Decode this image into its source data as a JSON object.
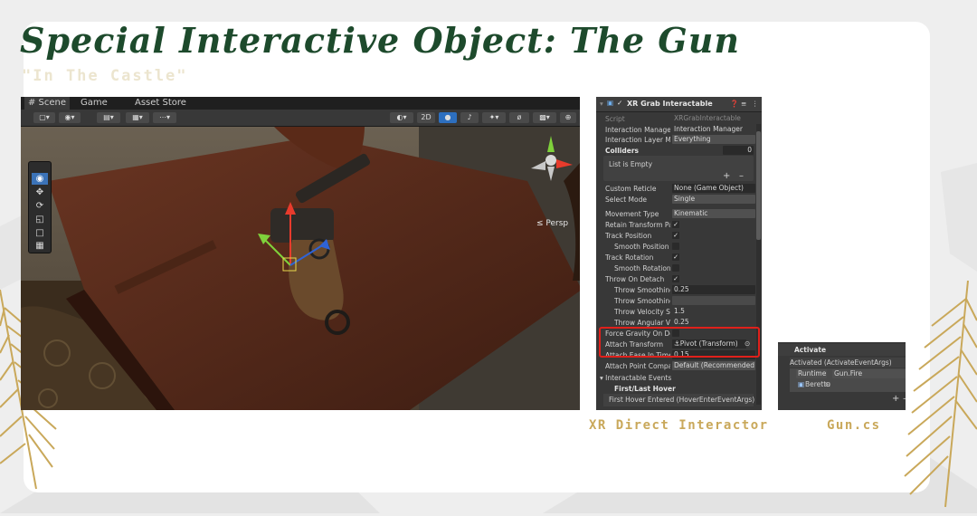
{
  "slide": {
    "title": "Special Interactive Object: The Gun",
    "subtitle": "\"In The Castle\"",
    "caption_inspector": "XR Direct Interactor",
    "caption_event": "Gun.cs",
    "colors": {
      "title": "#1d4a2c",
      "caption": "#c9a85a",
      "highlight": "#e0201b"
    }
  },
  "scene": {
    "tabs": [
      "# Scene",
      "Game",
      "Asset Store"
    ],
    "toolbar": {
      "mode_2d": "2D"
    },
    "persp_label": "≤ Persp",
    "tools": [
      "view-tool-icon",
      "move-tool-icon",
      "rotate-tool-icon",
      "scale-tool-icon",
      "rect-tool-icon",
      "transform-tool-icon"
    ]
  },
  "inspector": {
    "component": "XR Grab Interactable",
    "rows": {
      "script": {
        "label": "Script",
        "value": "XRGrabInteractable"
      },
      "interaction_manager": {
        "label": "Interaction Manager",
        "value": "Interaction Manager"
      },
      "interaction_layer": {
        "label": "Interaction Layer Ma",
        "value": "Everything"
      },
      "colliders": {
        "label": "Colliders",
        "value": "0"
      },
      "list_empty": "List is Empty",
      "custom_reticle": {
        "label": "Custom Reticle",
        "value": "None (Game Object)"
      },
      "select_mode": {
        "label": "Select Mode",
        "value": "Single"
      },
      "movement_type": {
        "label": "Movement Type",
        "value": "Kinematic"
      },
      "retain_transform": {
        "label": "Retain Transform Pa"
      },
      "track_position": {
        "label": "Track Position"
      },
      "smooth_position": {
        "label": "Smooth Position"
      },
      "track_rotation": {
        "label": "Track Rotation"
      },
      "smooth_rotation": {
        "label": "Smooth Rotation"
      },
      "throw_on_detach": {
        "label": "Throw On Detach"
      },
      "throw_smoothing_duration": {
        "label": "Throw Smoothing",
        "value": "0.25"
      },
      "throw_smoothing_curve": {
        "label": "Throw Smoothing"
      },
      "throw_velocity_scale": {
        "label": "Throw Velocity Sc",
        "value": "1.5"
      },
      "throw_angular_velocity": {
        "label": "Throw Angular Ve",
        "value": "0.25"
      },
      "force_gravity": {
        "label": "Force Gravity On Det"
      },
      "attach_transform": {
        "label": "Attach Transform",
        "value": "⚓Pivot (Transform)"
      },
      "attach_ease": {
        "label": "Attach Ease In Time",
        "value": "0.15"
      },
      "attach_point_compat": {
        "label": "Attach Point Compat",
        "value": "Default (Recommended"
      },
      "interactable_events": {
        "label": "Interactable Events"
      },
      "first_last_hover": {
        "label": "First/Last Hover"
      },
      "first_hover_entered": {
        "label": "First Hover Entered (HoverEnterEventArgs)"
      }
    }
  },
  "event_panel": {
    "header": "Activate",
    "event_name": "Activated (ActivateEventArgs)",
    "runtime": "Runtime (▾",
    "function": "Gun.Fire",
    "object": "Berettu"
  }
}
